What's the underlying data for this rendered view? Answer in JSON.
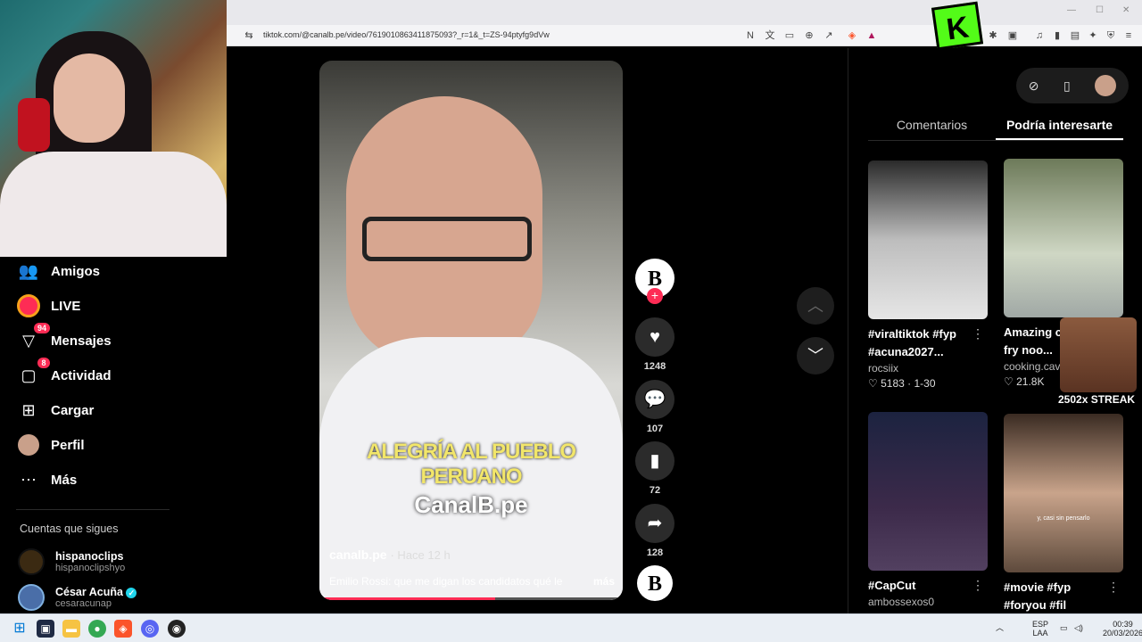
{
  "browser": {
    "url": "tiktok.com/@canalb.pe/video/7619010863411875093?_r=1&_t=ZS-94ptyfg9dVw"
  },
  "overlay": {
    "kick_logo": "K",
    "streak_text": "2502x STREAK"
  },
  "sidebar": {
    "items": [
      {
        "label": "Amigos",
        "icon": "friends-icon"
      },
      {
        "label": "LIVE",
        "icon": "live-icon"
      },
      {
        "label": "Mensajes",
        "icon": "messages-icon",
        "badge": "94"
      },
      {
        "label": "Actividad",
        "icon": "activity-icon",
        "badge": "8"
      },
      {
        "label": "Cargar",
        "icon": "upload-icon"
      },
      {
        "label": "Perfil",
        "icon": "profile-avatar"
      },
      {
        "label": "Más",
        "icon": "more-icon"
      }
    ],
    "follows_title": "Cuentas que sigues",
    "follows": [
      {
        "name": "hispanoclips",
        "handle": "hispanoclipshyo"
      },
      {
        "name": "César Acuña",
        "handle": "cesaracunap"
      }
    ]
  },
  "video": {
    "caption_line1": "ALEGRÍA AL PUEBLO",
    "caption_line2": "PERUANO",
    "watermark": "CanalB.pe",
    "author": "canalb.pe",
    "time": "· Hace 12 h",
    "description": "Emilio Rossi: que me digan los candidatos qué le",
    "more_label": "más",
    "progress": 0.58
  },
  "actions": {
    "avatar_letter": "B",
    "likes": "1248",
    "comments": "107",
    "saves": "72",
    "shares": "128"
  },
  "right_panel": {
    "tabs": [
      {
        "label": "Comentarios",
        "active": false
      },
      {
        "label": "Podría interesarte",
        "active": true
      }
    ],
    "cards": [
      {
        "title": "#viraltiktok #fyp #acuna2027...",
        "user": "rocsiix",
        "likes": "5183",
        "date": "1-30"
      },
      {
        "title": "Amazing c... stir fry noo...",
        "user": "cooking.cav...",
        "likes": "21.8K",
        "date": ""
      },
      {
        "title": "#CapCut",
        "user": "ambossexos0",
        "likes": "",
        "date": ""
      },
      {
        "title": "#movie #fyp #foryou #fil",
        "user": "",
        "likes": "",
        "date": ""
      }
    ],
    "card4_subtitle": "y, casi sin pensarlo"
  },
  "taskbar": {
    "lang_line1": "ESP",
    "lang_line2": "LAA",
    "time": "00:39",
    "date": "20/03/2026"
  }
}
